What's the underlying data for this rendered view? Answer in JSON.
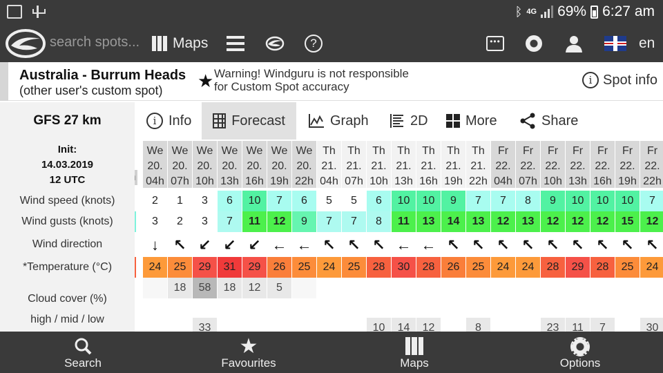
{
  "status_bar": {
    "network": "4G",
    "battery": "69%",
    "time": "6:27 am"
  },
  "header": {
    "search_placeholder": "search spots...",
    "maps_label": "Maps",
    "language": "en"
  },
  "spot": {
    "name": "Australia - Burrum Heads",
    "subtitle": "(other user's custom spot)",
    "warning_line1": "Warning! Windguru is not responsible",
    "warning_line2": "for Custom Spot accuracy",
    "info_label": "Spot info"
  },
  "tabs": {
    "model": "GFS 27 km",
    "info": "Info",
    "forecast": "Forecast",
    "graph": "Graph",
    "twod": "2D",
    "more": "More",
    "share": "Share"
  },
  "forecast": {
    "init_label": "Init:",
    "init_date": "14.03.2019",
    "init_time": "12 UTC",
    "row_labels": {
      "wind_speed": "Wind speed (knots)",
      "wind_gusts": "Wind gusts (knots)",
      "wind_direction": "Wind direction",
      "temperature": "*Temperature (°C)",
      "cloud_cover": "Cloud cover (%)",
      "cloud_levels": "high / mid / low"
    },
    "partial_column": {
      "day": "",
      "date": "",
      "hour": "h",
      "gust": "",
      "temp": ""
    },
    "columns": [
      {
        "day": "We",
        "date": "20.",
        "hour": "04h",
        "speed": "2",
        "gust": "3",
        "dir": "↓",
        "temp": "24",
        "cloud_high": "",
        "cloud_low": ""
      },
      {
        "day": "We",
        "date": "20.",
        "hour": "07h",
        "speed": "1",
        "gust": "2",
        "dir": "↖",
        "temp": "25",
        "cloud_high": "18",
        "cloud_low": ""
      },
      {
        "day": "We",
        "date": "20.",
        "hour": "10h",
        "speed": "3",
        "gust": "3",
        "dir": "↙",
        "temp": "29",
        "cloud_high": "58",
        "cloud_low": "33"
      },
      {
        "day": "We",
        "date": "20.",
        "hour": "13h",
        "speed": "6",
        "gust": "7",
        "dir": "↙",
        "temp": "31",
        "cloud_high": "18",
        "cloud_low": ""
      },
      {
        "day": "We",
        "date": "20.",
        "hour": "16h",
        "speed": "10",
        "gust": "11",
        "dir": "↙",
        "temp": "29",
        "cloud_high": "12",
        "cloud_low": ""
      },
      {
        "day": "We",
        "date": "20.",
        "hour": "19h",
        "speed": "7",
        "gust": "12",
        "dir": "←",
        "temp": "26",
        "cloud_high": "5",
        "cloud_low": ""
      },
      {
        "day": "We",
        "date": "20.",
        "hour": "22h",
        "speed": "6",
        "gust": "9",
        "dir": "←",
        "temp": "25",
        "cloud_high": "",
        "cloud_low": ""
      },
      {
        "day": "Th",
        "date": "21.",
        "hour": "04h",
        "speed": "5",
        "gust": "7",
        "dir": "↖",
        "temp": "24",
        "cloud_high": "",
        "cloud_low": ""
      },
      {
        "day": "Th",
        "date": "21.",
        "hour": "07h",
        "speed": "5",
        "gust": "7",
        "dir": "↖",
        "temp": "25",
        "cloud_high": "",
        "cloud_low": ""
      },
      {
        "day": "Th",
        "date": "21.",
        "hour": "10h",
        "speed": "6",
        "gust": "8",
        "dir": "↖",
        "temp": "28",
        "cloud_high": "",
        "cloud_low": "10"
      },
      {
        "day": "Th",
        "date": "21.",
        "hour": "13h",
        "speed": "10",
        "gust": "11",
        "dir": "←",
        "temp": "30",
        "cloud_high": "",
        "cloud_low": "14"
      },
      {
        "day": "Th",
        "date": "21.",
        "hour": "16h",
        "speed": "10",
        "gust": "13",
        "dir": "←",
        "temp": "28",
        "cloud_high": "",
        "cloud_low": "12"
      },
      {
        "day": "Th",
        "date": "21.",
        "hour": "19h",
        "speed": "9",
        "gust": "14",
        "dir": "↖",
        "temp": "26",
        "cloud_high": "",
        "cloud_low": ""
      },
      {
        "day": "Th",
        "date": "21.",
        "hour": "22h",
        "speed": "7",
        "gust": "13",
        "dir": "↖",
        "temp": "25",
        "cloud_high": "",
        "cloud_low": "8"
      },
      {
        "day": "Fr",
        "date": "22.",
        "hour": "04h",
        "speed": "7",
        "gust": "12",
        "dir": "↖",
        "temp": "24",
        "cloud_high": "",
        "cloud_low": ""
      },
      {
        "day": "Fr",
        "date": "22.",
        "hour": "07h",
        "speed": "8",
        "gust": "13",
        "dir": "↖",
        "temp": "24",
        "cloud_high": "",
        "cloud_low": ""
      },
      {
        "day": "Fr",
        "date": "22.",
        "hour": "10h",
        "speed": "9",
        "gust": "12",
        "dir": "↖",
        "temp": "28",
        "cloud_high": "",
        "cloud_low": "23"
      },
      {
        "day": "Fr",
        "date": "22.",
        "hour": "13h",
        "speed": "10",
        "gust": "12",
        "dir": "↖",
        "temp": "29",
        "cloud_high": "",
        "cloud_low": "11"
      },
      {
        "day": "Fr",
        "date": "22.",
        "hour": "16h",
        "speed": "10",
        "gust": "12",
        "dir": "↖",
        "temp": "28",
        "cloud_high": "",
        "cloud_low": "7"
      },
      {
        "day": "Fr",
        "date": "22.",
        "hour": "19h",
        "speed": "10",
        "gust": "15",
        "dir": "↖",
        "temp": "25",
        "cloud_high": "",
        "cloud_low": ""
      },
      {
        "day": "Fr",
        "date": "22.",
        "hour": "22h",
        "speed": "7",
        "gust": "12",
        "dir": "↖",
        "temp": "24",
        "cloud_high": "",
        "cloud_low": "30"
      }
    ]
  },
  "bottom_nav": {
    "search": "Search",
    "favourites": "Favourites",
    "maps": "Maps",
    "options": "Options"
  }
}
